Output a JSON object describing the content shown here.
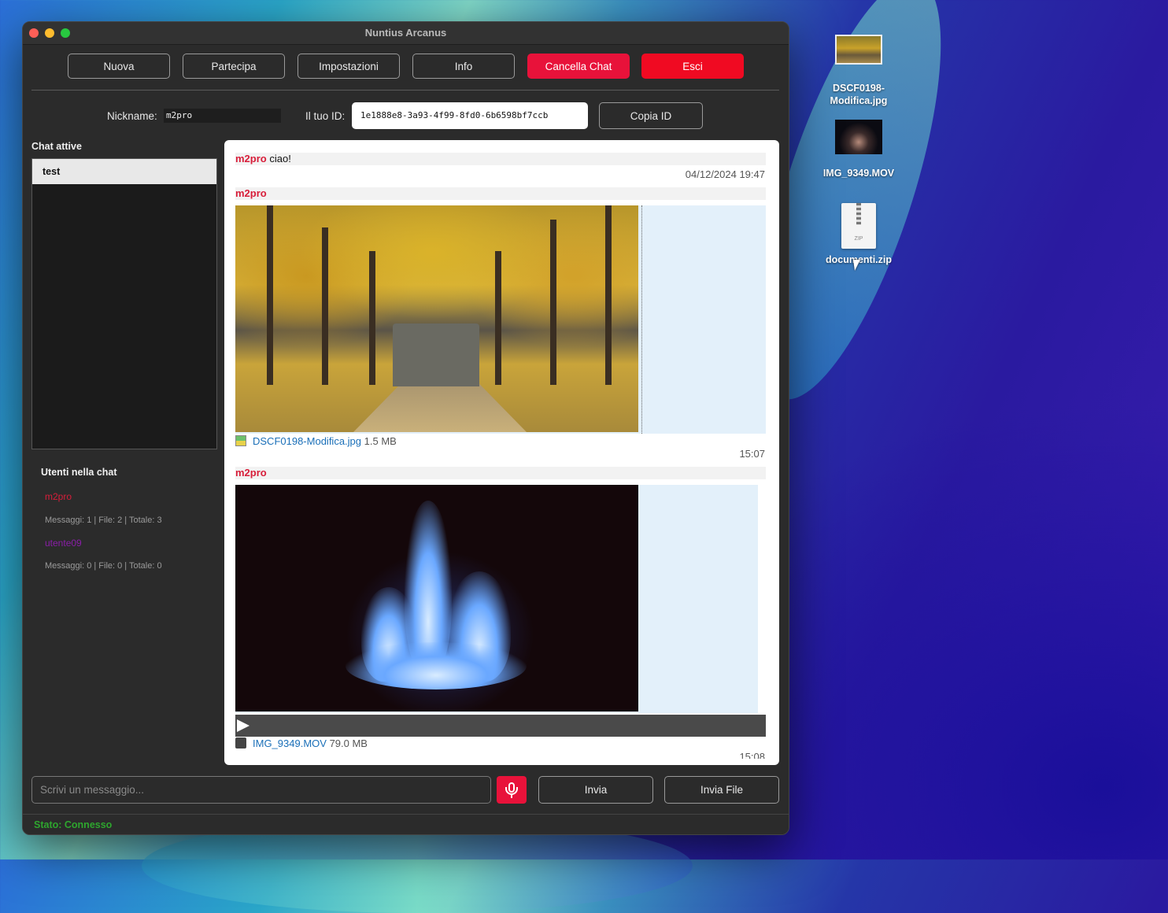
{
  "desktop": {
    "icons": [
      {
        "label": "DSCF0198-\nModifica.jpg",
        "line1": "DSCF0198-",
        "line2": "Modifica.jpg"
      },
      {
        "label": "IMG_9349.MOV"
      },
      {
        "label": "documenti.zip",
        "badge": "ZIP"
      }
    ]
  },
  "window": {
    "title": "Nuntius Arcanus",
    "toolbar": [
      "Nuova",
      "Partecipa",
      "Impostazioni",
      "Info",
      "Cancella Chat",
      "Esci"
    ],
    "nickname_label": "Nickname:",
    "nickname_value": "m2pro",
    "id_label": "Il tuo ID:",
    "id_value": "1e1888e8-3a93-4f99-8fd0-6b6598bf7ccb",
    "copy_id": "Copia ID"
  },
  "sidebar": {
    "active_chats_title": "Chat attive",
    "chats": [
      "test"
    ],
    "users_title": "Utenti nella chat",
    "users": [
      {
        "name": "m2pro",
        "stats": "Messaggi: 1 | File: 2 | Totale: 3",
        "color": "#d81e3a"
      },
      {
        "name": "utente09",
        "stats": "Messaggi: 0 | File: 0 | Totale: 0",
        "color": "#8a1ea8"
      }
    ]
  },
  "messages": [
    {
      "sender": "m2pro",
      "text": "ciao!",
      "time": "04/12/2024 19:47"
    },
    {
      "sender": "m2pro",
      "file": "DSCF0198-Modifica.jpg",
      "size": "1.5 MB",
      "time": "15:07"
    },
    {
      "sender": "m2pro",
      "file": "IMG_9349.MOV",
      "size": "79.0 MB",
      "time": "15:08"
    }
  ],
  "composer": {
    "placeholder": "Scrivi un messaggio...",
    "send": "Invia",
    "send_file": "Invia File"
  },
  "status": "Stato: Connesso"
}
